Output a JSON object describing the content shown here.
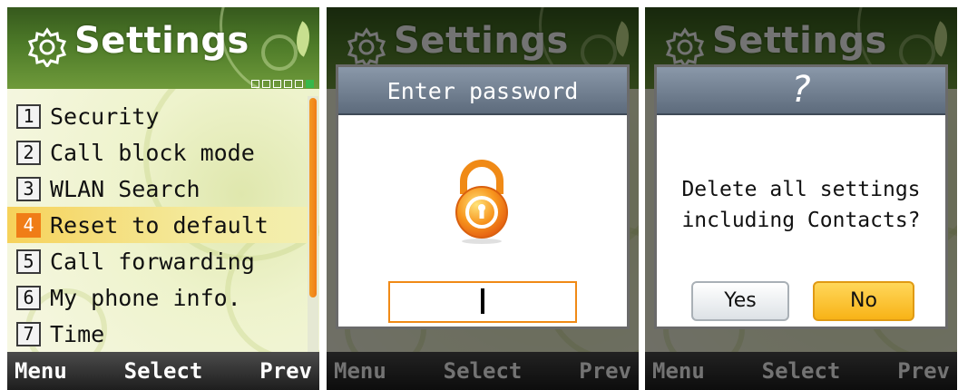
{
  "header": {
    "title": "Settings",
    "icon": "gear-icon",
    "page_indicator": {
      "count": 6,
      "active": 6
    }
  },
  "menu": {
    "selected_index": 3,
    "items": [
      {
        "num": "1",
        "label": "Security"
      },
      {
        "num": "2",
        "label": "Call block mode"
      },
      {
        "num": "3",
        "label": "WLAN Search"
      },
      {
        "num": "4",
        "label": "Reset to default"
      },
      {
        "num": "5",
        "label": "Call forwarding"
      },
      {
        "num": "6",
        "label": "My phone info."
      },
      {
        "num": "7",
        "label": "Time"
      }
    ]
  },
  "softkeys": {
    "left": "Menu",
    "center": "Select",
    "right": "Prev"
  },
  "password_dialog": {
    "title": "Enter password",
    "icon": "lock-icon",
    "value": ""
  },
  "confirm_dialog": {
    "title": "?",
    "message_line1": "Delete all settings",
    "message_line2": "including Contacts?",
    "yes_label": "Yes",
    "no_label": "No"
  },
  "colors": {
    "accent": "#f07d17",
    "header": "#4d7a28",
    "highlight": "#f6d25a",
    "dialog_title": "#6f7d8e"
  }
}
